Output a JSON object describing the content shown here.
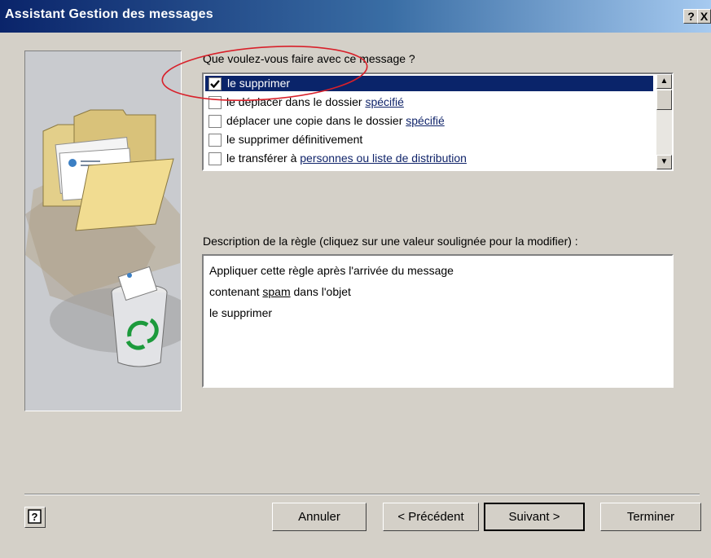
{
  "window": {
    "title": "Assistant Gestion des messages",
    "help_btn": "?",
    "close_btn": "X"
  },
  "actions": {
    "prompt": "Que voulez-vous faire avec ce message ?",
    "items": [
      {
        "text": "le supprimer",
        "link": "",
        "checked": true,
        "selected": true
      },
      {
        "text": "le déplacer dans le dossier ",
        "link": "spécifié",
        "checked": false,
        "selected": false
      },
      {
        "text": "déplacer une copie dans le dossier ",
        "link": "spécifié",
        "checked": false,
        "selected": false
      },
      {
        "text": "le supprimer définitivement",
        "link": "",
        "checked": false,
        "selected": false
      },
      {
        "text": "le transférer à ",
        "link": "personnes ou liste de distribution",
        "checked": false,
        "selected": false
      }
    ]
  },
  "description": {
    "label": "Description de la règle (cliquez sur une valeur soulignée pour la modifier) :",
    "line1": "Appliquer cette règle après l'arrivée du message",
    "line2_pre": "contenant ",
    "line2_link": "spam",
    "line2_post": " dans l'objet",
    "line3": "le supprimer"
  },
  "buttons": {
    "cancel": "Annuler",
    "previous": "< Précédent",
    "next": "Suivant >",
    "finish": "Terminer"
  },
  "colors": {
    "selection": "#0a246a",
    "link": "#10246a",
    "annotation": "#d8202a"
  }
}
